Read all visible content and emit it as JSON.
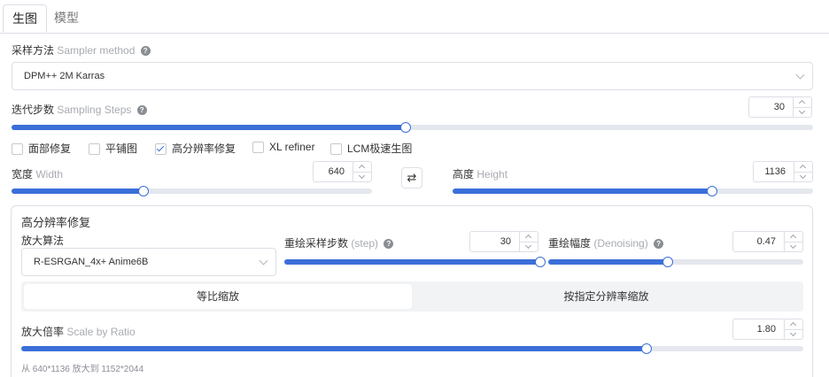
{
  "tabs": [
    {
      "label": "生图",
      "active": true
    },
    {
      "label": "模型",
      "active": false
    }
  ],
  "sampler": {
    "label": "采样方法",
    "sublabel": "Sampler method",
    "value": "DPM++ 2M Karras"
  },
  "steps": {
    "label": "迭代步数",
    "sublabel": "Sampling Steps",
    "value": "30",
    "fraction": 0.492
  },
  "checkboxes": [
    {
      "label": "面部修复",
      "checked": false
    },
    {
      "label": "平铺图",
      "checked": false
    },
    {
      "label": "高分辨率修复",
      "checked": true
    },
    {
      "label": "XL refiner",
      "checked": false
    },
    {
      "label": "LCM极速生图",
      "checked": false
    }
  ],
  "width": {
    "label": "宽度",
    "sublabel": "Width",
    "value": "640",
    "fraction": 0.365
  },
  "height": {
    "label": "高度",
    "sublabel": "Height",
    "value": "1136",
    "fraction": 0.719
  },
  "swap_symbol": "⇄",
  "hires": {
    "title": "高分辨率修复",
    "upscaler": {
      "label": "放大算法",
      "value": "R-ESRGAN_4x+ Anime6B"
    },
    "hires_steps": {
      "label": "重绘采样步数",
      "sublabel": "(step)",
      "value": "30",
      "fraction": 1.0
    },
    "denoising": {
      "label": "重绘幅度",
      "sublabel": "(Denoising)",
      "value": "0.47",
      "fraction": 0.47
    },
    "modes": [
      {
        "label": "等比缩放",
        "active": true
      },
      {
        "label": "按指定分辨率缩放",
        "active": false
      }
    ],
    "scale": {
      "label": "放大倍率",
      "sublabel": "Scale by Ratio",
      "value": "1.80",
      "fraction": 0.8
    },
    "note": "从 640*1136 放大到 1152*2044"
  },
  "colors": {
    "accent": "#3b6fd8",
    "track": "#e4e7ed",
    "border": "#dcdfe6"
  }
}
